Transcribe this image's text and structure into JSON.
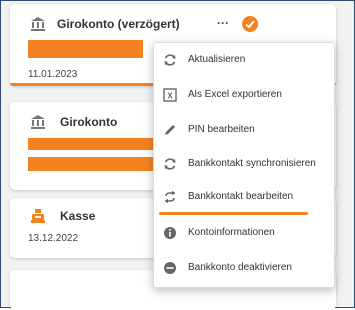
{
  "accounts": [
    {
      "title": "Girokonto (verzögert)",
      "more": "···",
      "date": "11.01.2023",
      "icon": "bank-icon",
      "status_icon": "check-icon"
    },
    {
      "title": "Girokonto",
      "icon": "bank-icon"
    },
    {
      "title": "Kasse",
      "date": "13.12.2022",
      "icon": "cash-register-icon"
    }
  ],
  "context_menu": {
    "items": [
      {
        "label": "Aktualisieren",
        "icon": "refresh-icon"
      },
      {
        "label": "Als Excel exportieren",
        "icon": "excel-icon"
      },
      {
        "label": "PIN bearbeiten",
        "icon": "pencil-icon"
      },
      {
        "label": "Bankkontakt synchronisieren",
        "icon": "sync-icon"
      },
      {
        "label": "Bankkontakt bearbeiten",
        "icon": "swap-icon"
      },
      {
        "label": "Kontoinformationen",
        "icon": "info-icon"
      },
      {
        "label": "Bankkonto deaktivieren",
        "icon": "minus-circle-icon"
      }
    ]
  },
  "colors": {
    "accent": "#f58220",
    "icon": "#777777"
  }
}
